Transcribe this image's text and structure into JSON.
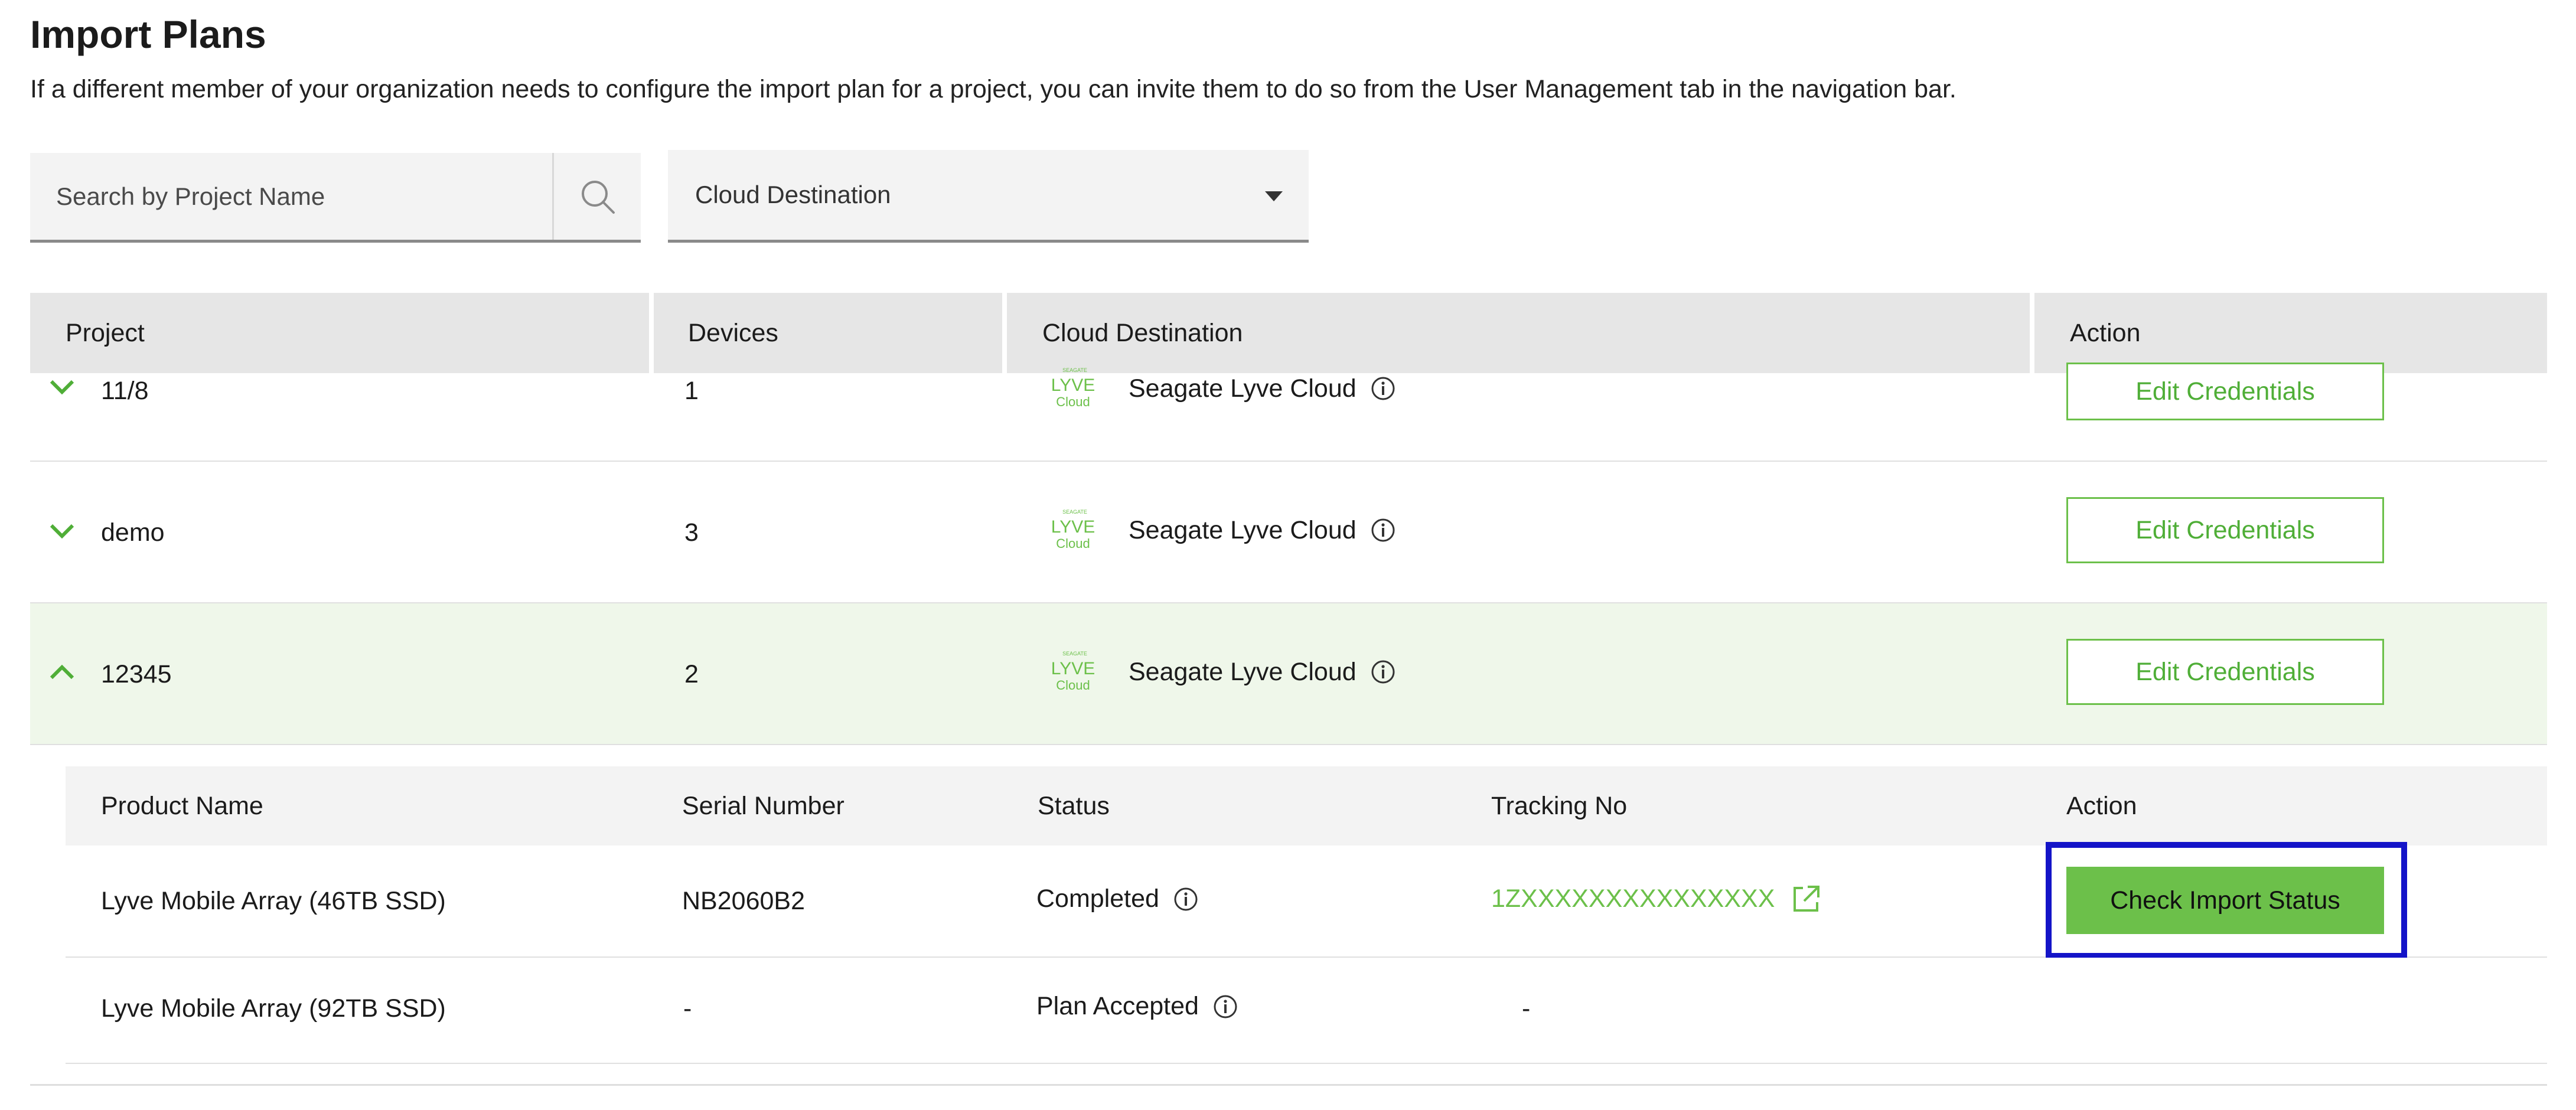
{
  "page": {
    "title": "Import Plans",
    "description": "If a different member of your organization needs to configure the import plan for a project, you can invite them to do so from the User Management tab in the navigation bar."
  },
  "filters": {
    "search_placeholder": "Search by Project Name",
    "search_icon": "search-icon",
    "destination_label": "Cloud Destination",
    "destination_icon": "caret-down-icon"
  },
  "table": {
    "headers": [
      "Project",
      "Devices",
      "Cloud Destination",
      "Action"
    ],
    "rows": [
      {
        "project": "11/8",
        "devices": "1",
        "cloud": "Seagate Lyve Cloud",
        "action": "Edit Credentials",
        "expanded": false
      },
      {
        "project": "demo",
        "devices": "3",
        "cloud": "Seagate Lyve Cloud",
        "action": "Edit Credentials",
        "expanded": false
      },
      {
        "project": "12345",
        "devices": "2",
        "cloud": "Seagate Lyve Cloud",
        "action": "Edit Credentials",
        "expanded": true
      }
    ]
  },
  "logo": {
    "top": "SEAGATE",
    "main": "LYVE",
    "sub": "Cloud"
  },
  "subtable": {
    "headers": [
      "Product Name",
      "Serial Number",
      "Status",
      "Tracking No",
      "Action"
    ],
    "rows": [
      {
        "product": "Lyve Mobile Array (46TB SSD)",
        "serial": "NB2060B2",
        "status": "Completed",
        "tracking": "1ZXXXXXXXXXXXXXXX",
        "action": "Check Import Status"
      },
      {
        "product": "Lyve Mobile Array (92TB SSD)",
        "serial": "-",
        "status": "Plan Accepted",
        "tracking": "-",
        "action": ""
      }
    ]
  },
  "colors": {
    "accent_green": "#6cc04a",
    "expanded_row_bg": "#eff7ea",
    "header_bg": "#e6e6e6",
    "highlight_border": "#1414c8"
  }
}
